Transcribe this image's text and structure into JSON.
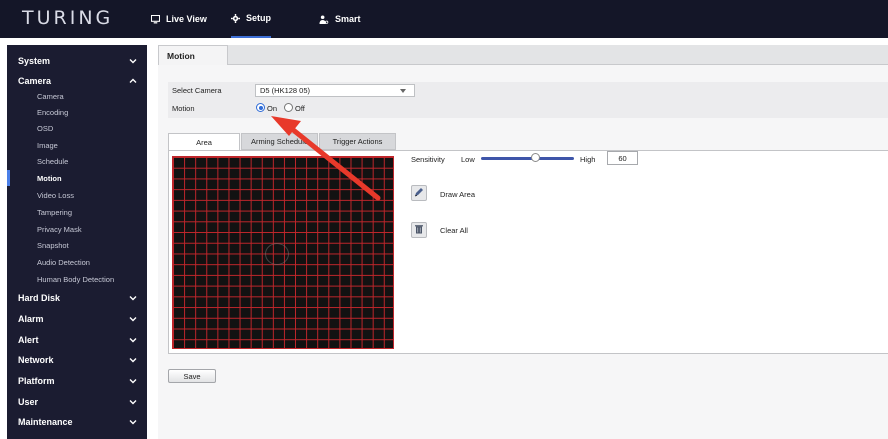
{
  "header": {
    "logo": "TURING",
    "nav": [
      {
        "label": "Live View",
        "icon": "monitor-icon"
      },
      {
        "label": "Setup",
        "icon": "gear-icon"
      },
      {
        "label": "Smart",
        "icon": "person-icon"
      }
    ],
    "active": "Setup"
  },
  "sidebar": {
    "sections": [
      {
        "label": "System",
        "icon": "chevron-down-icon"
      },
      {
        "label": "Camera",
        "icon": "chevron-up-icon"
      },
      {
        "label": "Hard Disk",
        "icon": "chevron-down-icon"
      },
      {
        "label": "Alarm",
        "icon": "chevron-down-icon"
      },
      {
        "label": "Alert",
        "icon": "chevron-down-icon"
      },
      {
        "label": "Network",
        "icon": "chevron-down-icon"
      },
      {
        "label": "Platform",
        "icon": "chevron-down-icon"
      },
      {
        "label": "User",
        "icon": "chevron-down-icon"
      },
      {
        "label": "Maintenance",
        "icon": "chevron-down-icon"
      }
    ],
    "camera_items": [
      "Camera",
      "Encoding",
      "OSD",
      "Image",
      "Schedule",
      "Motion",
      "Video Loss",
      "Tampering",
      "Privacy Mask",
      "Snapshot",
      "Audio Detection",
      "Human Body Detection"
    ],
    "active_item": "Motion"
  },
  "page": {
    "tab_title": "Motion",
    "select_camera_label": "Select Camera",
    "select_camera_value": "D5 (HK128 05)",
    "motion_label": "Motion",
    "radio_on": "On",
    "radio_off": "Off",
    "motion_state": "On",
    "tabs": [
      "Area",
      "Arming Schedule",
      "Trigger Actions"
    ],
    "active_tab": "Area",
    "sensitivity_label": "Sensitivity",
    "low_label": "Low",
    "high_label": "High",
    "sensitivity_value": "60",
    "draw_area_label": "Draw Area",
    "clear_all_label": "Clear All",
    "save_label": "Save"
  },
  "colors": {
    "topbar": "#141628",
    "sidebar": "#1b1c31",
    "grid_line": "#c0262b",
    "accent": "#2f6cd8",
    "arrow": "#e8392a"
  }
}
